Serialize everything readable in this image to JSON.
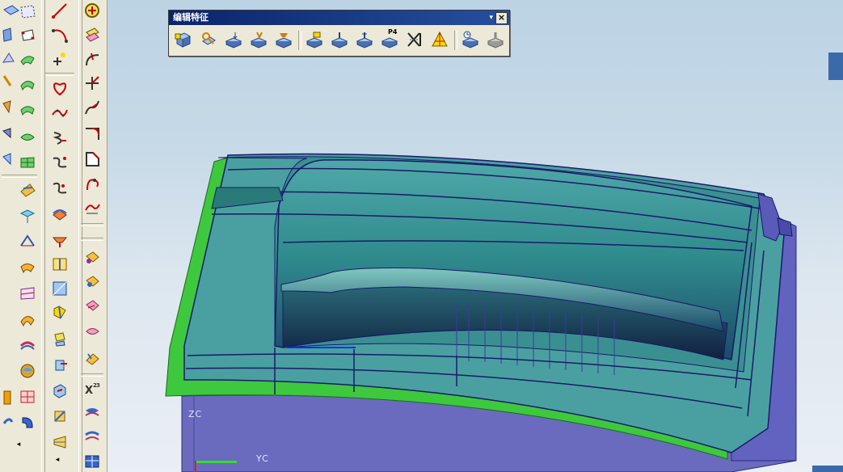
{
  "floating_toolbar": {
    "title": "编辑特征",
    "dropdown_glyph": "▾",
    "close_glyph": "×",
    "tools": [
      {
        "name": "edit-feature-parameters-icon"
      },
      {
        "name": "edit-positioning-icon"
      },
      {
        "name": "move-feature-icon"
      },
      {
        "name": "reorder-feature-icon"
      },
      {
        "name": "replace-feature-icon"
      },
      {
        "name": "suppress-feature-icon"
      },
      {
        "name": "unsuppress-feature-icon"
      },
      {
        "name": "suppress-by-expression-icon"
      },
      {
        "name": "p4-icon",
        "label": "P4"
      },
      {
        "name": "remove-parameters-icon"
      },
      {
        "name": "edit-solid-density-icon"
      },
      {
        "name": "playback-icon"
      },
      {
        "name": "update-feature-icon"
      }
    ]
  },
  "viewport": {
    "axis_zc": "ZC",
    "axis_yc": "YC",
    "model_colors": {
      "cavity": "#2e7f86",
      "base": "#6666b8",
      "rim": "#3ec83e",
      "edges": "#1a1a6a"
    }
  },
  "toolbar_columns": {
    "col1_icons": [
      "surface-icon",
      "face-icon",
      "ruled-surface-icon",
      "through-curves-icon",
      "through-curve-mesh-icon",
      "swept-icon",
      "section-surface-icon",
      "bridge-surface-icon",
      "n-sided-surface-icon",
      "offset-surface-icon",
      "extension-icon",
      "law-extension-icon",
      "trim-sheet-icon",
      "sew-icon",
      "thicken-icon",
      "patch-icon",
      "fillet-icon",
      "blend-icon",
      "transition-icon",
      "styled-sweep-icon",
      "x-form-icon"
    ],
    "col2_icons": [
      "line-icon",
      "arc-icon",
      "point-icon",
      "spline-icon",
      "studio-spline-icon",
      "helix-icon",
      "offset-curve-icon",
      "bridge-curve-icon",
      "project-curve-icon",
      "combined-curve-icon",
      "intersection-curve-icon",
      "section-curve-icon",
      "isoparametric-curve-icon",
      "extract-curve-icon",
      "join-curve-icon",
      "wrap-curve-icon",
      "trim-curve-icon"
    ],
    "col3_icons": [
      "point-set-icon",
      "extract-geometry-icon",
      "trim-corner-icon",
      "divide-curve-icon",
      "curve-length-icon",
      "fillet-curve-icon",
      "chamfer-curve-icon",
      "edit-curve-icon",
      "arc-length-icon",
      "smooth-spline-icon",
      "law-curve-icon",
      "surface-analysis-icon",
      "curve-analysis-icon",
      "deviation-icon",
      "reflection-icon",
      "expression-icon",
      "x-power-icon",
      "shape-icon",
      "section-analysis-icon",
      "face-curvature-icon"
    ]
  }
}
